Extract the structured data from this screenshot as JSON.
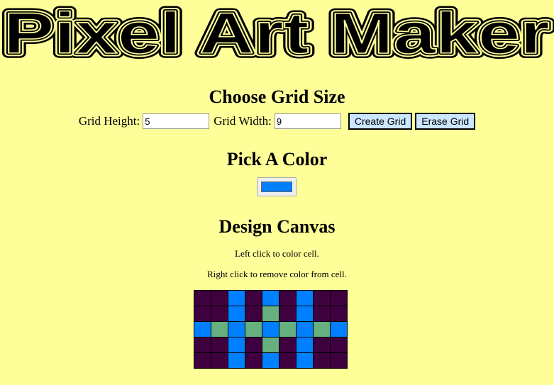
{
  "title": "Pixel Art Maker",
  "grid_size": {
    "heading": "Choose Grid Size",
    "height_label": "Grid Height:",
    "height_value": "5",
    "width_label": "Grid Width:",
    "width_value": "9",
    "create_button": "Create Grid",
    "erase_button": "Erase Grid"
  },
  "color_section": {
    "heading": "Pick A Color",
    "selected_color": "#0080ff"
  },
  "canvas_section": {
    "heading": "Design Canvas",
    "instruction_left": "Left click to color cell.",
    "instruction_right": "Right click to remove color from cell."
  },
  "palette": {
    "page_background": "#ffff99",
    "button_background": "#cce6ff",
    "cell_default": "#3f0040",
    "cell_blue": "#0080ff",
    "cell_green": "#66b07f"
  },
  "canvas_grid": [
    [
      "d",
      "d",
      "b",
      "d",
      "b",
      "d",
      "b",
      "d",
      "d"
    ],
    [
      "d",
      "d",
      "b",
      "d",
      "g",
      "d",
      "b",
      "d",
      "d"
    ],
    [
      "b",
      "g",
      "b",
      "g",
      "b",
      "g",
      "b",
      "g",
      "b"
    ],
    [
      "d",
      "d",
      "b",
      "d",
      "g",
      "d",
      "b",
      "d",
      "d"
    ],
    [
      "d",
      "d",
      "b",
      "d",
      "b",
      "d",
      "b",
      "d",
      "d"
    ]
  ]
}
